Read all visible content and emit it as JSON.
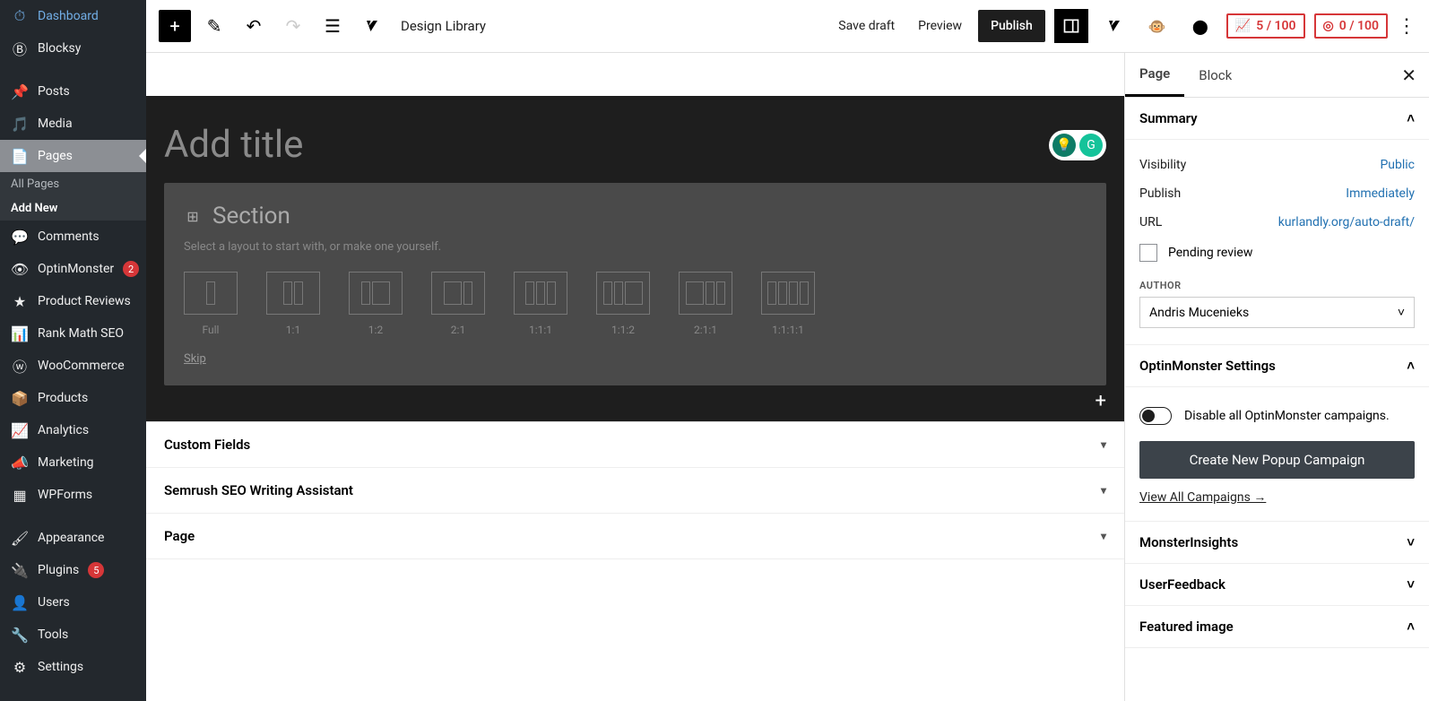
{
  "sidebar": {
    "items": [
      {
        "icon": "dashboard",
        "label": "Dashboard"
      },
      {
        "icon": "blocksy",
        "label": "Blocksy"
      },
      {
        "icon": "pin",
        "label": "Posts"
      },
      {
        "icon": "media",
        "label": "Media"
      },
      {
        "icon": "page",
        "label": "Pages",
        "active": true,
        "sub": [
          {
            "label": "All Pages"
          },
          {
            "label": "Add New",
            "current": true
          }
        ]
      },
      {
        "icon": "comment",
        "label": "Comments"
      },
      {
        "icon": "optin",
        "label": "OptinMonster",
        "badge": "2"
      },
      {
        "icon": "star",
        "label": "Product Reviews"
      },
      {
        "icon": "rank",
        "label": "Rank Math SEO"
      },
      {
        "icon": "woo",
        "label": "WooCommerce"
      },
      {
        "icon": "products",
        "label": "Products"
      },
      {
        "icon": "analytics",
        "label": "Analytics"
      },
      {
        "icon": "marketing",
        "label": "Marketing"
      },
      {
        "icon": "wpforms",
        "label": "WPForms"
      },
      {
        "icon": "appearance",
        "label": "Appearance"
      },
      {
        "icon": "plugins",
        "label": "Plugins",
        "badge": "5"
      },
      {
        "icon": "users",
        "label": "Users"
      },
      {
        "icon": "tools",
        "label": "Tools"
      },
      {
        "icon": "settings",
        "label": "Settings"
      }
    ]
  },
  "toolbar": {
    "design_library": "Design Library",
    "save_draft": "Save draft",
    "preview": "Preview",
    "publish": "Publish",
    "score1": "5 / 100",
    "score2": "0 / 100"
  },
  "editor": {
    "title_placeholder": "Add title",
    "section_title": "Section",
    "section_hint": "Select a layout to start with, or make one yourself.",
    "layouts": [
      {
        "label": "Full",
        "cols": [
          1
        ]
      },
      {
        "label": "1:1",
        "cols": [
          1,
          1
        ]
      },
      {
        "label": "1:2",
        "cols": [
          1,
          2
        ]
      },
      {
        "label": "2:1",
        "cols": [
          2,
          1
        ]
      },
      {
        "label": "1:1:1",
        "cols": [
          1,
          1,
          1
        ]
      },
      {
        "label": "1:1:2",
        "cols": [
          1,
          1,
          2
        ]
      },
      {
        "label": "2:1:1",
        "cols": [
          2,
          1,
          1
        ]
      },
      {
        "label": "1:1:1:1",
        "cols": [
          1,
          1,
          1,
          1
        ]
      }
    ],
    "skip": "Skip",
    "meta_panels": [
      {
        "title": "Custom Fields"
      },
      {
        "title": "Semrush SEO Writing Assistant"
      },
      {
        "title": "Page"
      }
    ]
  },
  "rsidebar": {
    "tabs": {
      "page": "Page",
      "block": "Block"
    },
    "summary": {
      "title": "Summary",
      "visibility_label": "Visibility",
      "visibility_value": "Public",
      "publish_label": "Publish",
      "publish_value": "Immediately",
      "url_label": "URL",
      "url_value": "kurlandly.org/auto-draft/",
      "pending_review": "Pending review",
      "author_label": "AUTHOR",
      "author_value": "Andris Mucenieks"
    },
    "optin": {
      "title": "OptinMonster Settings",
      "toggle_label": "Disable all OptinMonster campaigns.",
      "create_button": "Create New Popup Campaign",
      "view_all": "View All Campaigns →"
    },
    "collapsed": [
      {
        "title": "MonsterInsights"
      },
      {
        "title": "UserFeedback"
      },
      {
        "title": "Featured image",
        "expanded": true
      }
    ]
  }
}
